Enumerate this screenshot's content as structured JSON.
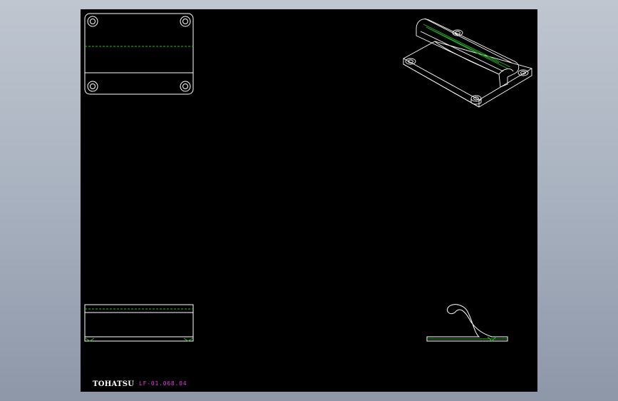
{
  "sheet": {
    "background": "#000000",
    "line_color": "#ffffff",
    "centerline_color": "#22c022",
    "title_color": "#e040e0"
  },
  "views": {
    "top_view": "top-view",
    "isometric_view": "isometric-view",
    "front_view": "front-view",
    "side_view": "side-view"
  },
  "title_block": {
    "company": "TOHATSU",
    "part_number": "LF-01.068.04"
  }
}
